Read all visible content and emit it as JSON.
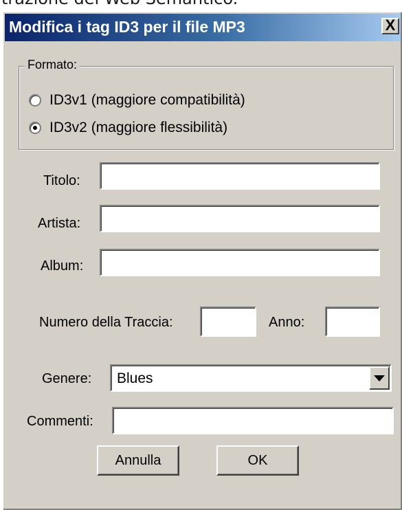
{
  "background_text": "trazione del Web Semantico.",
  "dialog": {
    "title": "Modifica i tag ID3 per il file MP3",
    "close_label": "X",
    "colors": {
      "face": "#d4d0c8",
      "titlebar_start": "#0a246a",
      "titlebar_end": "#a6caf0"
    }
  },
  "format_group": {
    "legend": "Formato:",
    "options": [
      {
        "label": "ID3v1 (maggiore compatibilità)",
        "checked": false
      },
      {
        "label": "ID3v2 (maggiore flessibilità)",
        "checked": true
      }
    ]
  },
  "fields": {
    "title": {
      "label": "Titolo:",
      "value": ""
    },
    "artist": {
      "label": "Artista:",
      "value": ""
    },
    "album": {
      "label": "Album:",
      "value": ""
    },
    "track": {
      "label": "Numero della Traccia:",
      "value": ""
    },
    "year": {
      "label": "Anno:",
      "value": ""
    },
    "genre": {
      "label": "Genere:",
      "value": "Blues"
    },
    "comments": {
      "label": "Commenti:",
      "value": ""
    }
  },
  "buttons": {
    "cancel": "Annulla",
    "ok": "OK"
  },
  "icons": {
    "close": "close-icon",
    "dropdown": "chevron-down-icon"
  }
}
